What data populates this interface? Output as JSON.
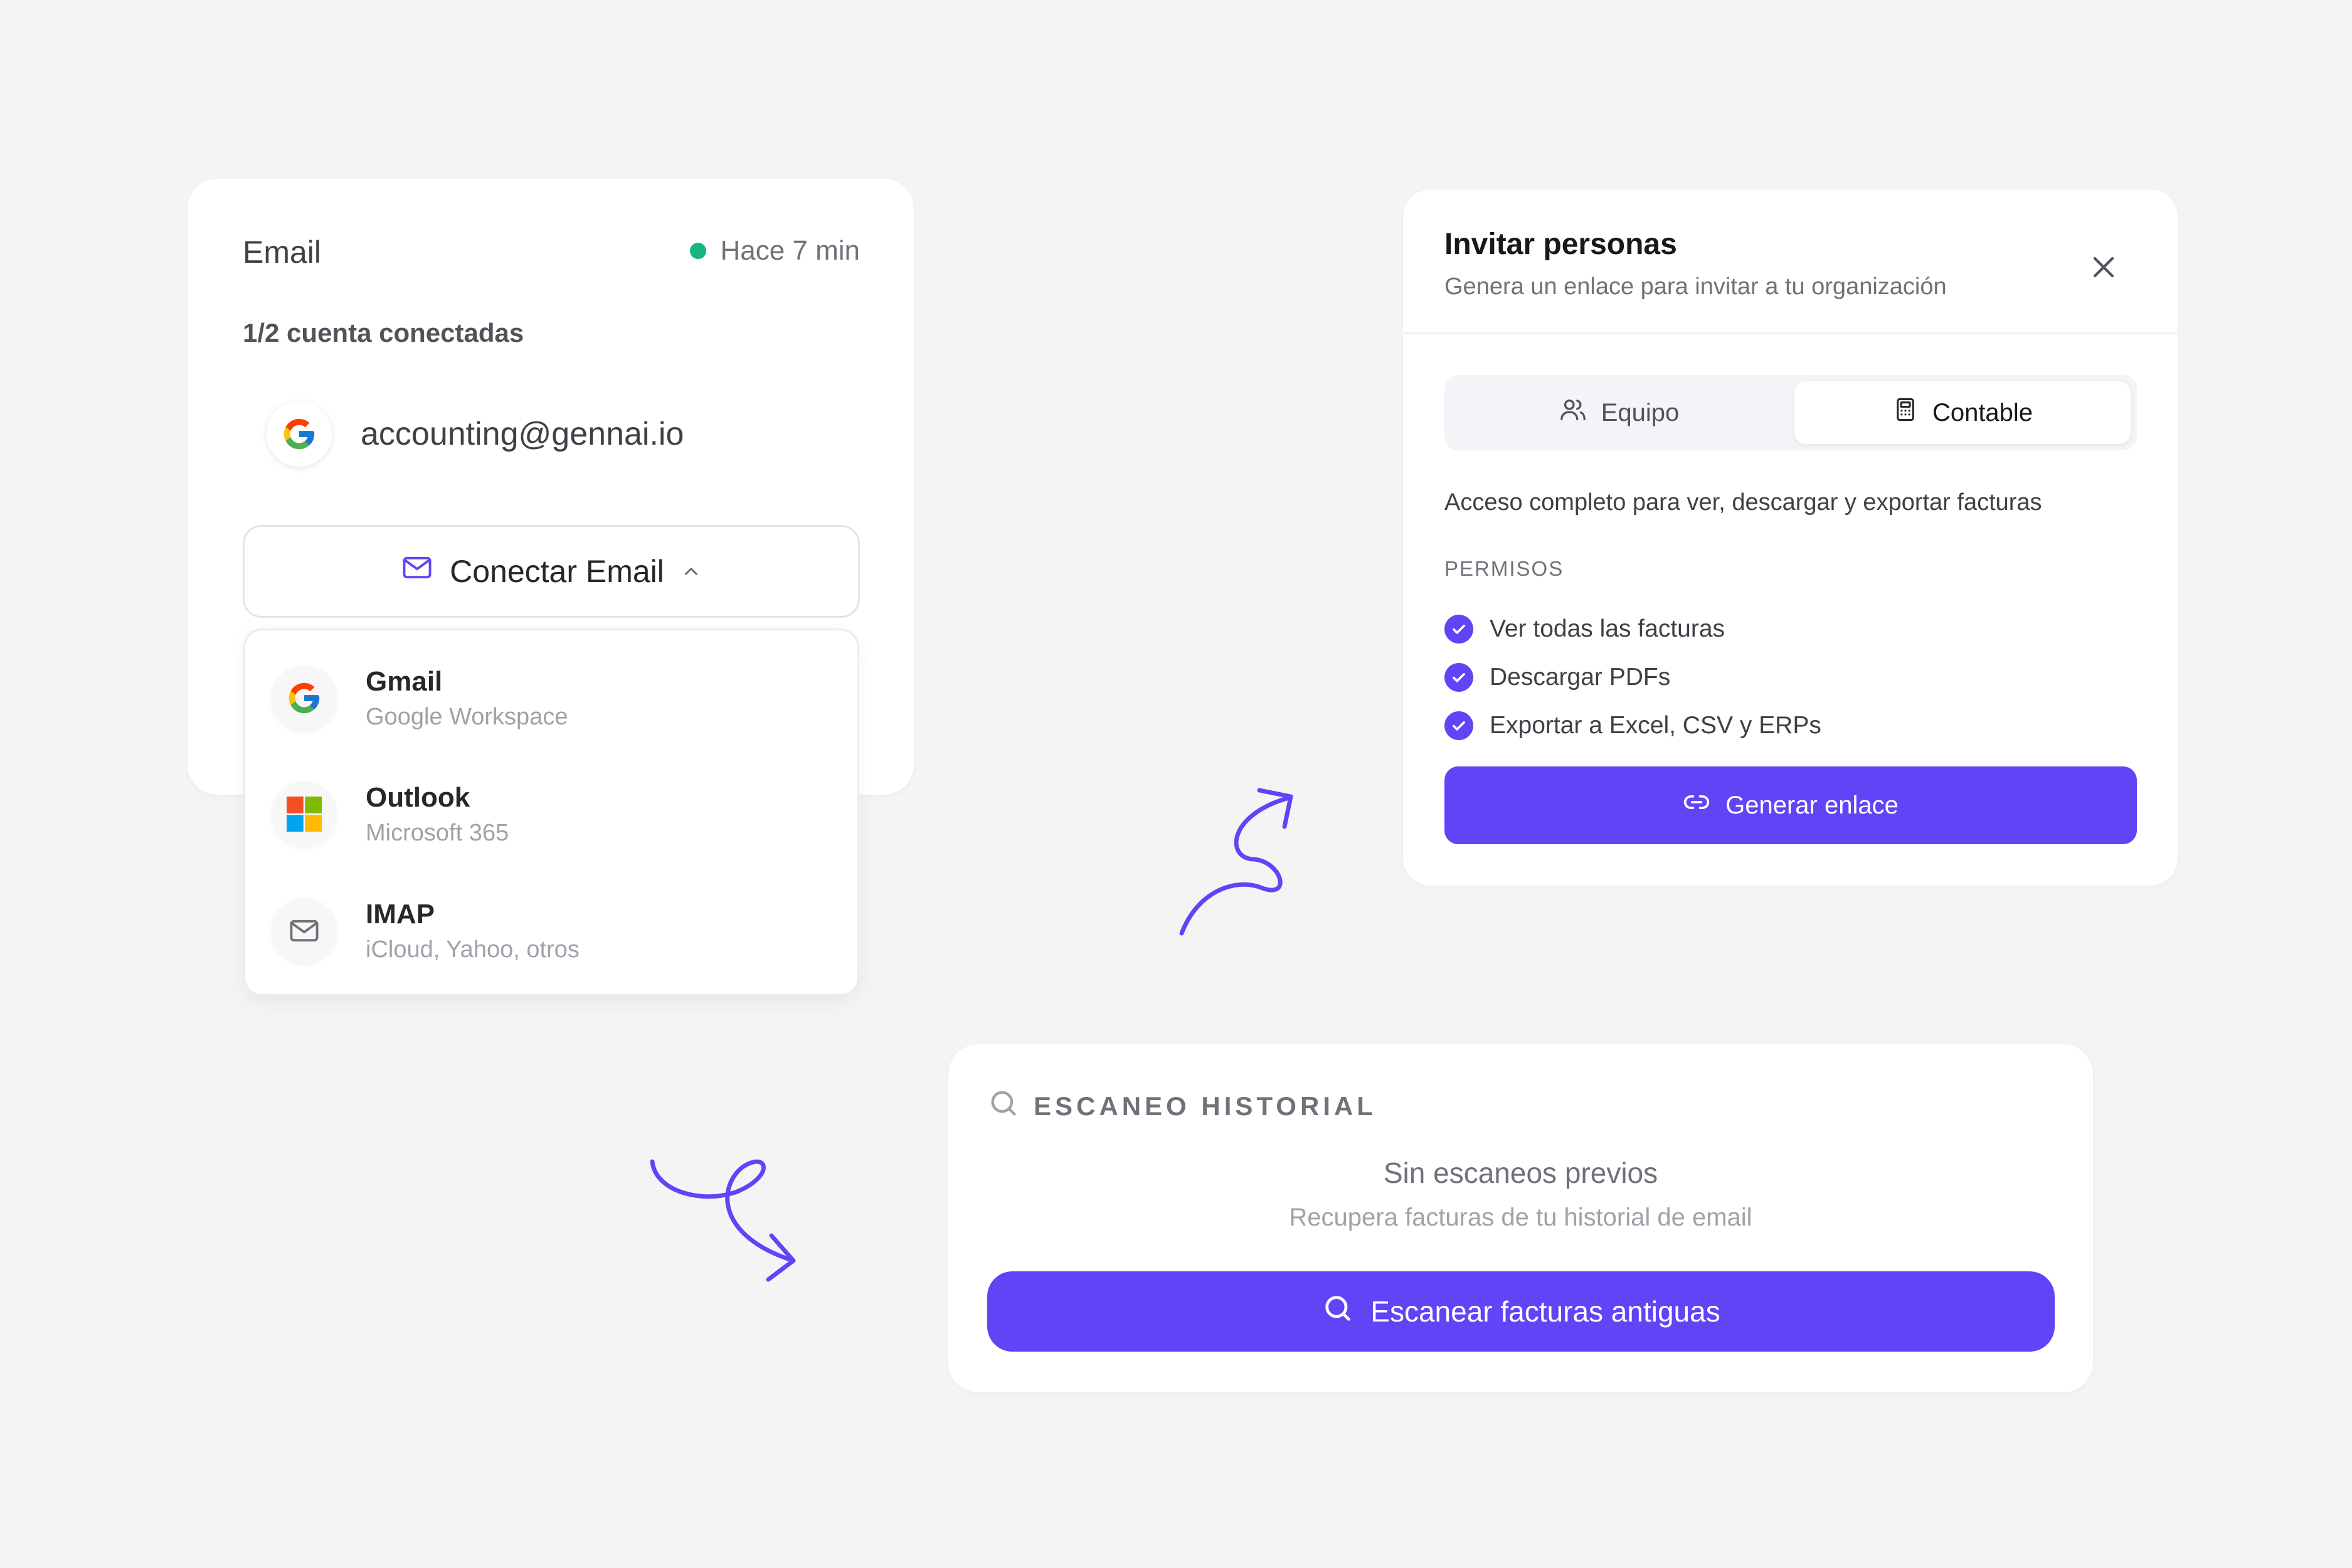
{
  "email_card": {
    "title": "Email",
    "status_text": "Hace 7 min",
    "accounts_count": "1/2 cuenta conectadas",
    "connected_account": "accounting@gennai.io",
    "connect_button": "Conectar Email"
  },
  "provider_menu": {
    "items": [
      {
        "name": "Gmail",
        "subtitle": "Google Workspace",
        "icon": "google-icon"
      },
      {
        "name": "Outlook",
        "subtitle": "Microsoft 365",
        "icon": "microsoft-icon"
      },
      {
        "name": "IMAP",
        "subtitle": "iCloud, Yahoo, otros",
        "icon": "mail-icon"
      }
    ]
  },
  "invite_card": {
    "title": "Invitar personas",
    "subtitle": "Genera un enlace para invitar a tu organización",
    "tabs": [
      {
        "label": "Equipo",
        "icon": "users-icon",
        "active": false
      },
      {
        "label": "Contable",
        "icon": "calculator-icon",
        "active": true
      }
    ],
    "role_description": "Acceso completo para ver, descargar y exportar facturas",
    "permissions_heading": "PERMISOS",
    "permissions": [
      "Ver todas las facturas",
      "Descargar PDFs",
      "Exportar a Excel, CSV y ERPs"
    ],
    "generate_button": "Generar enlace"
  },
  "scan_card": {
    "heading": "ESCANEO HISTORIAL",
    "empty_title": "Sin escaneos previos",
    "empty_subtitle": "Recupera facturas de tu historial de email",
    "scan_button": "Escanear facturas antiguas"
  },
  "colors": {
    "accent": "#6144f5",
    "status_online": "#16b77e",
    "background": "#f4f4f5"
  }
}
